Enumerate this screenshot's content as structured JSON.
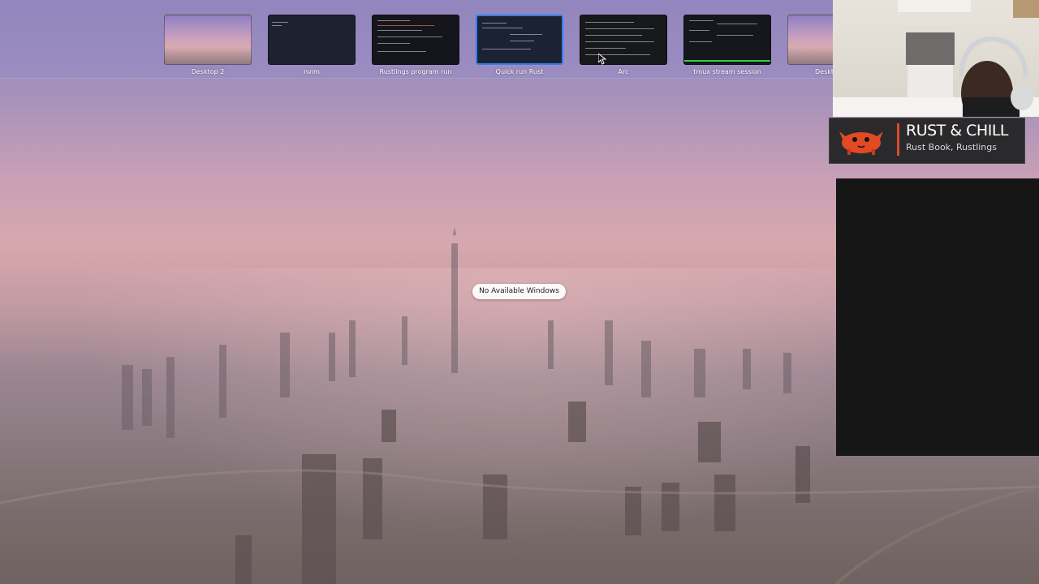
{
  "desktop": {
    "message": "No Available Windows"
  },
  "spaces": [
    {
      "label": "Desktop 2",
      "kind": "wallpaper",
      "active": false
    },
    {
      "label": "nvim",
      "kind": "dark",
      "active": false
    },
    {
      "label": "Rustlings program run",
      "kind": "terminal",
      "active": false
    },
    {
      "label": "Quick run Rust",
      "kind": "terminal",
      "active": true
    },
    {
      "label": "Arc",
      "kind": "terminal",
      "active": false
    },
    {
      "label": "tmux stream session",
      "kind": "tmux",
      "active": false
    },
    {
      "label": "Deskt",
      "kind": "wallpaper",
      "active": false
    }
  ],
  "overlay": {
    "title": "RUST & CHILL",
    "subtitle": "Rust Book, Rustlings"
  },
  "colors": {
    "accent": "#2f7ff0",
    "brand": "#e04a2a",
    "tmux_bar": "#33d14a"
  },
  "icons": {
    "cursor": "arrow-cursor-icon",
    "crab": "ferris-crab-icon"
  }
}
